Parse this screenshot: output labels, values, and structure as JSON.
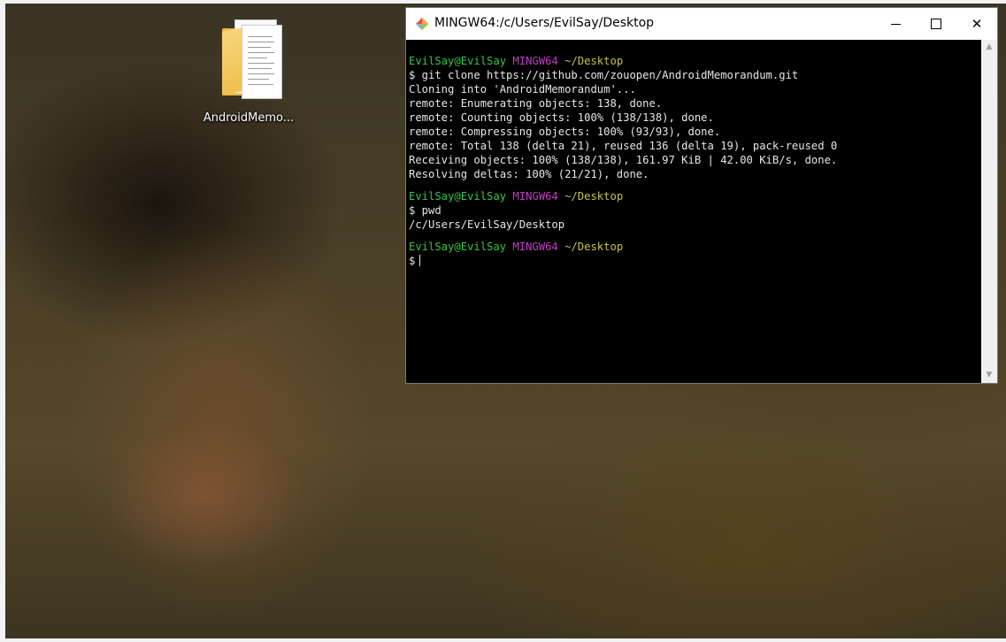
{
  "desktop": {
    "icon_label": "AndroidMemo..."
  },
  "window": {
    "title": "MINGW64:/c/Users/EvilSay/Desktop",
    "controls": {
      "minimize": "—",
      "maximize": "☐",
      "close": "✕"
    }
  },
  "terminal": {
    "prompt_user": "EvilSay@EvilSay",
    "prompt_env": "MINGW64",
    "prompt_dir": "~/Desktop",
    "cmd1": "$ git clone https://github.com/zouopen/AndroidMemorandum.git",
    "out1": [
      "Cloning into 'AndroidMemorandum'...",
      "remote: Enumerating objects: 138, done.",
      "remote: Counting objects: 100% (138/138), done.",
      "remote: Compressing objects: 100% (93/93), done.",
      "remote: Total 138 (delta 21), reused 136 (delta 19), pack-reused 0",
      "Receiving objects: 100% (138/138), 161.97 KiB | 42.00 KiB/s, done.",
      "Resolving deltas: 100% (21/21), done."
    ],
    "cmd2": "$ pwd",
    "out2": "/c/Users/EvilSay/Desktop",
    "prompt_symbol": "$"
  },
  "colors": {
    "prompt_user": "#33c649",
    "prompt_env": "#c33bc6",
    "prompt_dir": "#c7c43c",
    "terminal_bg": "#000000",
    "terminal_fg": "#e6e6e6"
  }
}
